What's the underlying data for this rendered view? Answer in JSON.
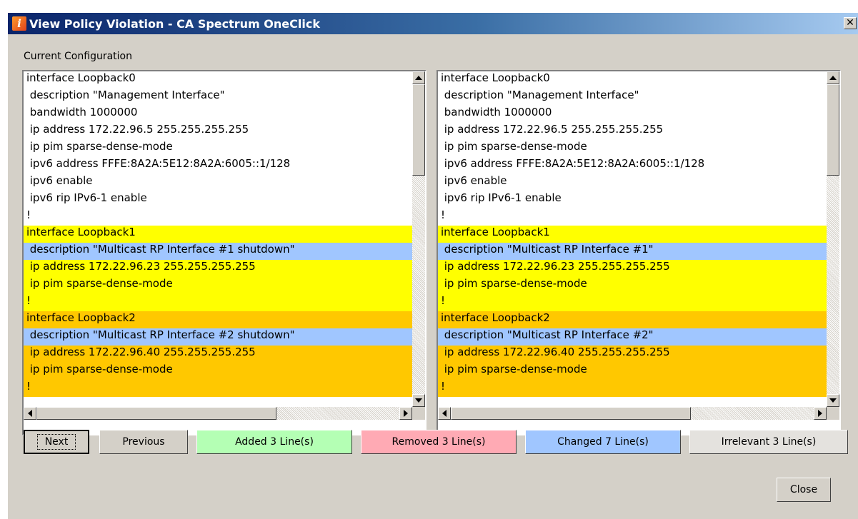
{
  "window": {
    "title": "View Policy Violation - CA Spectrum OneClick",
    "icon_letter": "i",
    "close_glyph": "✕"
  },
  "config_label": "Current Configuration",
  "highlight_colors": {
    "white": "#ffffff",
    "yellow": "#ffff00",
    "orange": "#ffc800",
    "blue": "#a0c6ff"
  },
  "left_pane": {
    "lines": [
      {
        "text": "interface Loopback0",
        "hl": "white"
      },
      {
        "text": " description \"Management Interface\"",
        "hl": "white"
      },
      {
        "text": " bandwidth 1000000",
        "hl": "white"
      },
      {
        "text": " ip address 172.22.96.5 255.255.255.255",
        "hl": "white"
      },
      {
        "text": " ip pim sparse-dense-mode",
        "hl": "white"
      },
      {
        "text": " ipv6 address FFFE:8A2A:5E12:8A2A:6005::1/128",
        "hl": "white"
      },
      {
        "text": " ipv6 enable",
        "hl": "white"
      },
      {
        "text": " ipv6 rip IPv6-1 enable",
        "hl": "white"
      },
      {
        "text": "!",
        "hl": "white"
      },
      {
        "text": "interface Loopback1",
        "hl": "yellow"
      },
      {
        "text": " description \"Multicast RP Interface #1 shutdown\"",
        "hl": "blue"
      },
      {
        "text": " ip address 172.22.96.23 255.255.255.255",
        "hl": "yellow"
      },
      {
        "text": " ip pim sparse-dense-mode",
        "hl": "yellow"
      },
      {
        "text": "!",
        "hl": "yellow"
      },
      {
        "text": "interface Loopback2",
        "hl": "orange"
      },
      {
        "text": " description \"Multicast RP Interface #2 shutdown\"",
        "hl": "blue"
      },
      {
        "text": " ip address 172.22.96.40 255.255.255.255",
        "hl": "orange"
      },
      {
        "text": " ip pim sparse-dense-mode",
        "hl": "orange"
      },
      {
        "text": "!",
        "hl": "orange"
      }
    ]
  },
  "right_pane": {
    "lines": [
      {
        "text": "interface Loopback0",
        "hl": "white"
      },
      {
        "text": " description \"Management Interface\"",
        "hl": "white"
      },
      {
        "text": " bandwidth 1000000",
        "hl": "white"
      },
      {
        "text": " ip address 172.22.96.5 255.255.255.255",
        "hl": "white"
      },
      {
        "text": " ip pim sparse-dense-mode",
        "hl": "white"
      },
      {
        "text": " ipv6 address FFFE:8A2A:5E12:8A2A:6005::1/128",
        "hl": "white"
      },
      {
        "text": " ipv6 enable",
        "hl": "white"
      },
      {
        "text": " ipv6 rip IPv6-1 enable",
        "hl": "white"
      },
      {
        "text": "!",
        "hl": "white"
      },
      {
        "text": "interface Loopback1",
        "hl": "yellow"
      },
      {
        "text": " description \"Multicast RP Interface #1\"",
        "hl": "blue"
      },
      {
        "text": " ip address 172.22.96.23 255.255.255.255",
        "hl": "yellow"
      },
      {
        "text": " ip pim sparse-dense-mode",
        "hl": "yellow"
      },
      {
        "text": "!",
        "hl": "yellow"
      },
      {
        "text": "interface Loopback2",
        "hl": "orange"
      },
      {
        "text": " description \"Multicast RP Interface #2\"",
        "hl": "blue"
      },
      {
        "text": " ip address 172.22.96.40 255.255.255.255",
        "hl": "orange"
      },
      {
        "text": " ip pim sparse-dense-mode",
        "hl": "orange"
      },
      {
        "text": "!",
        "hl": "orange"
      }
    ]
  },
  "buttons": {
    "next": "Next",
    "previous": "Previous",
    "added": "Added 3 Line(s)",
    "removed": "Removed 3 Line(s)",
    "changed": "Changed 7 Line(s)",
    "irrelevant": "Irrelevant 3 Line(s)",
    "close": "Close"
  },
  "button_colors": {
    "default": "#d4d0c8",
    "added": "#b4ffb4",
    "removed": "#ffaab4",
    "changed": "#a0c6ff",
    "irrelevant": "#e4e2de"
  }
}
